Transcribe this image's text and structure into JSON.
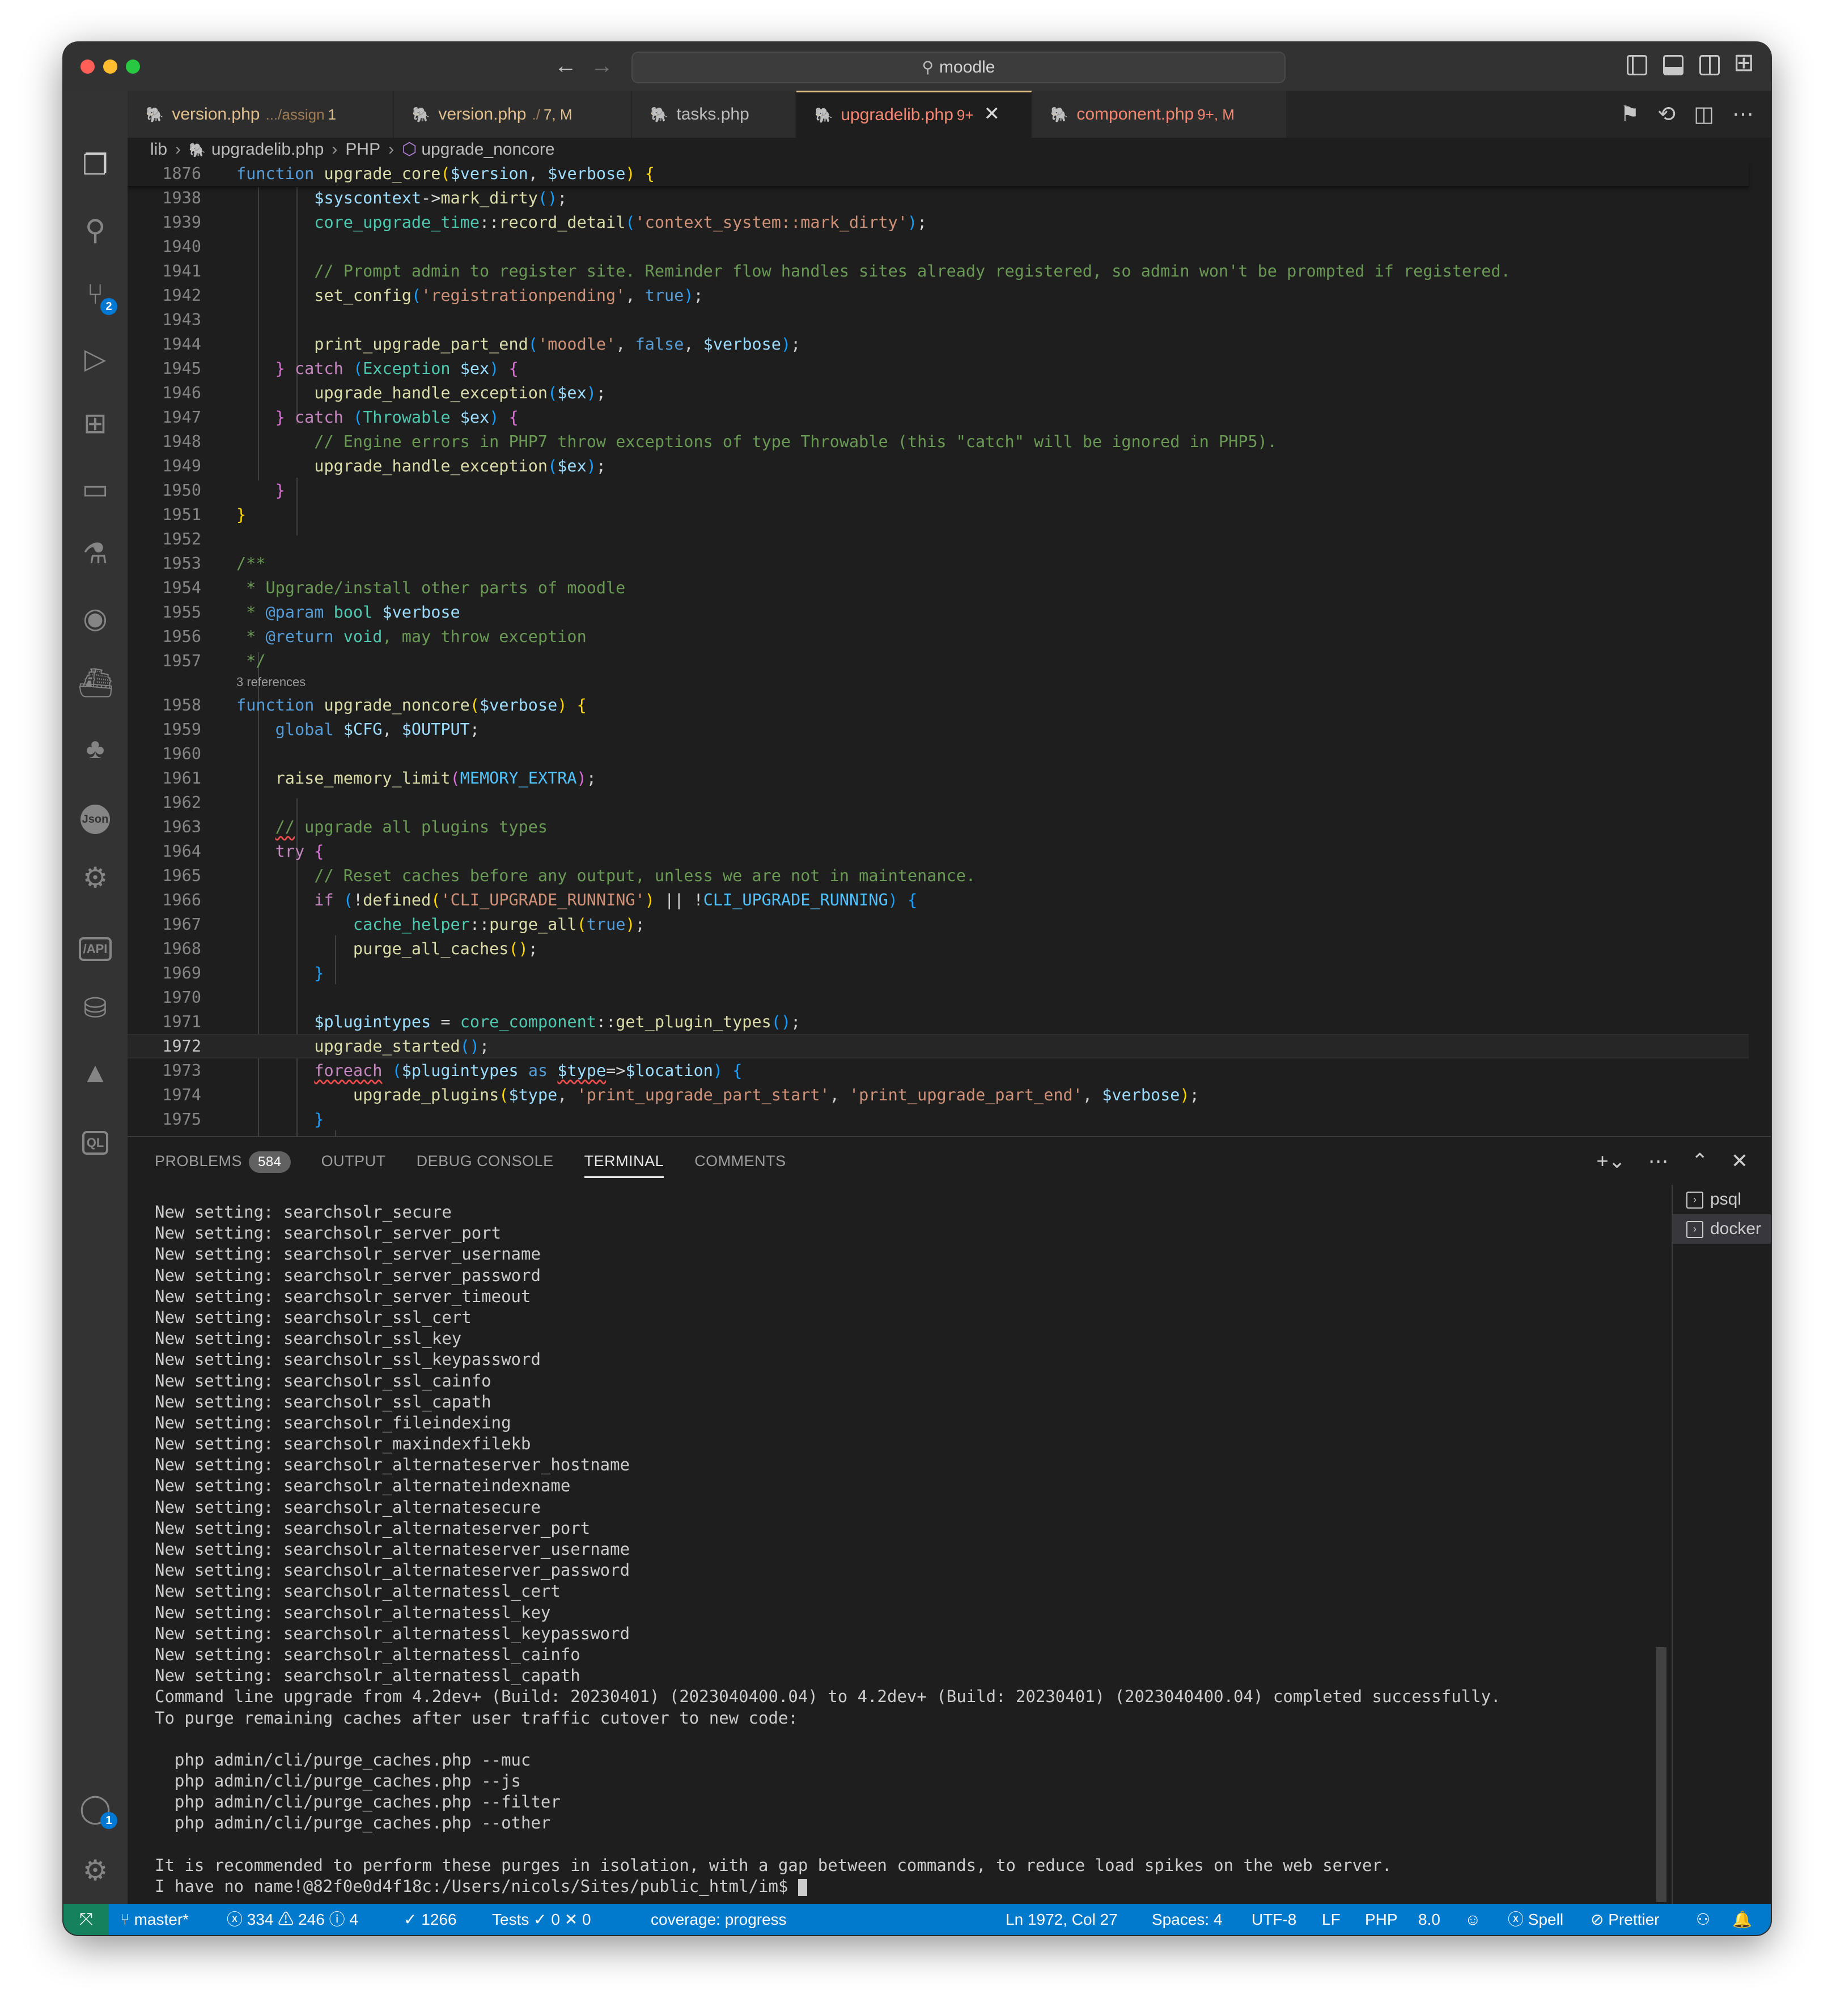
{
  "window": {
    "search_text": "moodle"
  },
  "activity_bar": {
    "scm_badge": "2",
    "accounts_badge": "1",
    "json_label": "Json",
    "api_label": "/API",
    "ql_label": "QL"
  },
  "tabs": [
    {
      "name": "version.php",
      "desc": ".../assign",
      "status": "1"
    },
    {
      "name": "version.php",
      "desc": "./",
      "status": "7, M"
    },
    {
      "name": "tasks.php",
      "desc": "",
      "status": ""
    },
    {
      "name": "upgradelib.php",
      "desc": "",
      "status": "9+"
    },
    {
      "name": "component.php",
      "desc": "",
      "status": "9+, M"
    }
  ],
  "breadcrumb": {
    "folder": "lib",
    "file": "upgradelib.php",
    "lang": "PHP",
    "symbol": "upgrade_noncore"
  },
  "editor": {
    "codelens": "3 references",
    "line_numbers": [
      "1876",
      "1938",
      "1939",
      "1940",
      "1941",
      "1942",
      "1943",
      "1944",
      "1945",
      "1946",
      "1947",
      "1948",
      "1949",
      "1950",
      "1951",
      "1952",
      "1953",
      "1954",
      "1955",
      "1956",
      "1957",
      "1958",
      "1959",
      "1960",
      "1961",
      "1962",
      "1963",
      "1964",
      "1965",
      "1966",
      "1967",
      "1968",
      "1969",
      "1970",
      "1971",
      "1972",
      "1973",
      "1974",
      "1975"
    ]
  },
  "panel": {
    "tabs": [
      "PROBLEMS",
      "OUTPUT",
      "DEBUG CONSOLE",
      "TERMINAL",
      "COMMENTS"
    ],
    "problems_count": "584",
    "terminals": [
      "psql",
      "docker"
    ],
    "terminal_lines": [
      "New setting: searchsolr_secure",
      "New setting: searchsolr_server_port",
      "New setting: searchsolr_server_username",
      "New setting: searchsolr_server_password",
      "New setting: searchsolr_server_timeout",
      "New setting: searchsolr_ssl_cert",
      "New setting: searchsolr_ssl_key",
      "New setting: searchsolr_ssl_keypassword",
      "New setting: searchsolr_ssl_cainfo",
      "New setting: searchsolr_ssl_capath",
      "New setting: searchsolr_fileindexing",
      "New setting: searchsolr_maxindexfilekb",
      "New setting: searchsolr_alternateserver_hostname",
      "New setting: searchsolr_alternateindexname",
      "New setting: searchsolr_alternatesecure",
      "New setting: searchsolr_alternateserver_port",
      "New setting: searchsolr_alternateserver_username",
      "New setting: searchsolr_alternateserver_password",
      "New setting: searchsolr_alternatessl_cert",
      "New setting: searchsolr_alternatessl_key",
      "New setting: searchsolr_alternatessl_keypassword",
      "New setting: searchsolr_alternatessl_cainfo",
      "New setting: searchsolr_alternatessl_capath",
      "Command line upgrade from 4.2dev+ (Build: 20230401) (2023040400.04) to 4.2dev+ (Build: 20230401) (2023040400.04) completed successfully.",
      "To purge remaining caches after user traffic cutover to new code:",
      "",
      "  php admin/cli/purge_caches.php --muc",
      "  php admin/cli/purge_caches.php --js",
      "  php admin/cli/purge_caches.php --filter",
      "  php admin/cli/purge_caches.php --other",
      "",
      "It is recommended to perform these purges in isolation, with a gap between commands, to reduce load spikes on the web server."
    ],
    "prompt": "I have no name!@82f0e0d4f18c:/Users/nicols/Sites/public_html/im$ "
  },
  "statusbar": {
    "branch": "master*",
    "errors": "334",
    "warnings": "246",
    "infos": "4",
    "checks": "1266",
    "tests_label": "Tests",
    "tests_pass": "0",
    "tests_fail": "0",
    "coverage": "coverage: progress",
    "position": "Ln 1972, Col 27",
    "spaces": "Spaces: 4",
    "encoding": "UTF-8",
    "eol": "LF",
    "language": "PHP",
    "version": "8.0",
    "spell": "Spell",
    "prettier": "Prettier"
  },
  "colors": {
    "statusbar": "#007acc",
    "remote": "#16825d",
    "modified_tab": "#e2c08d",
    "error_tab": "#f48771",
    "php_icon": "#b180d7"
  }
}
